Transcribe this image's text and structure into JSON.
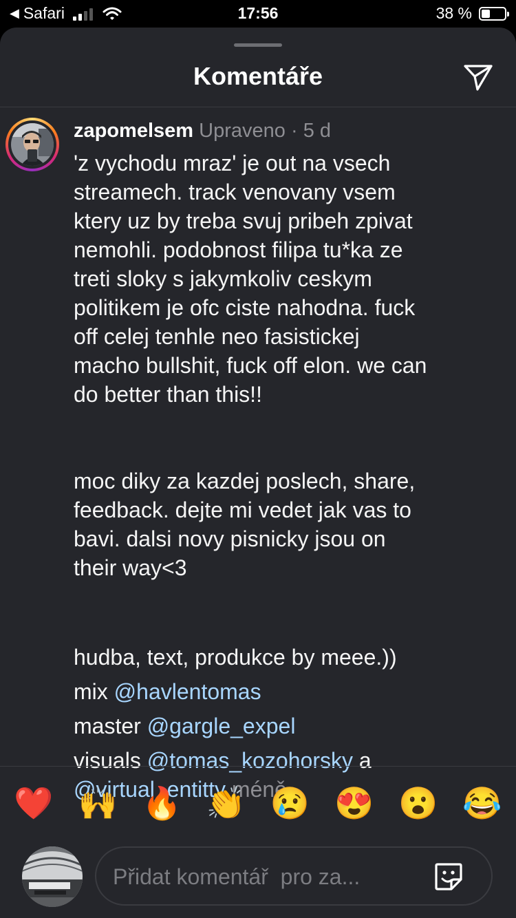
{
  "status_bar": {
    "back_app": "Safari",
    "time": "17:56",
    "battery_percent": "38 %",
    "battery_level": 0.38,
    "signal_bars_filled": 2,
    "icons": [
      "back-arrow-icon",
      "signal-icon",
      "wifi-icon",
      "battery-icon"
    ]
  },
  "sheet": {
    "title": "Komentáře",
    "share_icon": "paper-plane-icon"
  },
  "comment": {
    "username": "zapomelsem",
    "edited_label": "Upraveno",
    "separator": "·",
    "age": "5 d",
    "paragraph1": [
      "'z vychodu mraz' je out na vsech",
      "streamech. track venovany vsem",
      "ktery uz by treba svuj pribeh zpivat",
      "nemohli. podobnost filipa tu*ka ze",
      "treti sloky s jakymkoliv ceskym",
      "politikem je ofc ciste nahodna. fuck",
      "off celej tenhle neo fasistickej",
      "macho bullshit, fuck off elon. we can",
      "do better than this!!"
    ],
    "paragraph2": [
      "moc diky za kazdej poslech, share,",
      "feedback. dejte mi vedet jak vas to",
      "bavi. dalsi novy pisnicky jsou on",
      "their way<3"
    ],
    "credits_intro": "hudba, text, produkce by meee.))",
    "mix_label": "mix",
    "mix_mention": "@havlentomas",
    "master_label": "master",
    "master_mention": "@gargle_expel",
    "visuals_label": "visuals",
    "visuals_mention": "@tomas_kozohorsky",
    "and_word": "a",
    "visuals_mention2": "@virtual_entitty",
    "less_label": "méně"
  },
  "reactions": [
    {
      "emoji": "❤️",
      "name": "red-heart-emoji"
    },
    {
      "emoji": "🙌",
      "name": "raising-hands-emoji"
    },
    {
      "emoji": "🔥",
      "name": "fire-emoji"
    },
    {
      "emoji": "👏",
      "name": "clapping-hands-emoji"
    },
    {
      "emoji": "😢",
      "name": "crying-face-emoji"
    },
    {
      "emoji": "😍",
      "name": "heart-eyes-emoji"
    },
    {
      "emoji": "😮",
      "name": "surprised-face-emoji"
    },
    {
      "emoji": "😂",
      "name": "tears-of-joy-emoji"
    }
  ],
  "composer": {
    "placeholder": "Přidat komentář  pro za...",
    "value": "",
    "sticker_icon": "sticker-icon"
  },
  "colors": {
    "sheet_background": "#25262b",
    "mention": "#a8d6ff",
    "muted_text": "#8e8e93",
    "divider": "#3a3b40"
  }
}
